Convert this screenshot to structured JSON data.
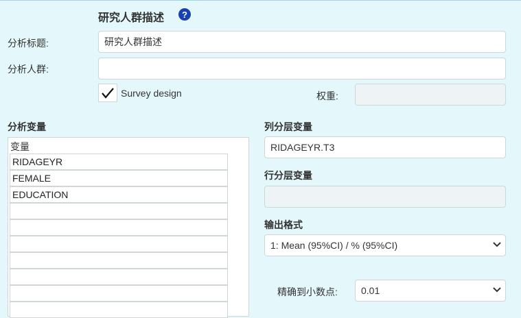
{
  "header": {
    "title": "研究人群描述",
    "help_icon": "question-circle-icon"
  },
  "form": {
    "analysis_title": {
      "label": "分析标题:",
      "value": "研究人群描述"
    },
    "analysis_population": {
      "label": "分析人群:",
      "value": ""
    },
    "survey_design": {
      "label": "Survey design",
      "checked": true
    },
    "weight": {
      "label": "权重:",
      "value": ""
    }
  },
  "variables": {
    "section_label": "分析变量",
    "list_header": "变量",
    "items": [
      "RIDAGEYR",
      "FEMALE",
      "EDUCATION",
      "",
      "",
      "",
      "",
      "",
      "",
      ""
    ]
  },
  "column_strata": {
    "label": "列分层变量",
    "value": "RIDAGEYR.T3"
  },
  "row_strata": {
    "label": "行分层变量",
    "value": ""
  },
  "output_format": {
    "label": "输出格式",
    "selected": "1: Mean (95%CI) / % (95%CI)"
  },
  "decimals": {
    "label": "精确到小数点:",
    "selected": "0.01"
  },
  "colors": {
    "background": "#e4f7fb",
    "help_icon": "#1a3fb3"
  }
}
